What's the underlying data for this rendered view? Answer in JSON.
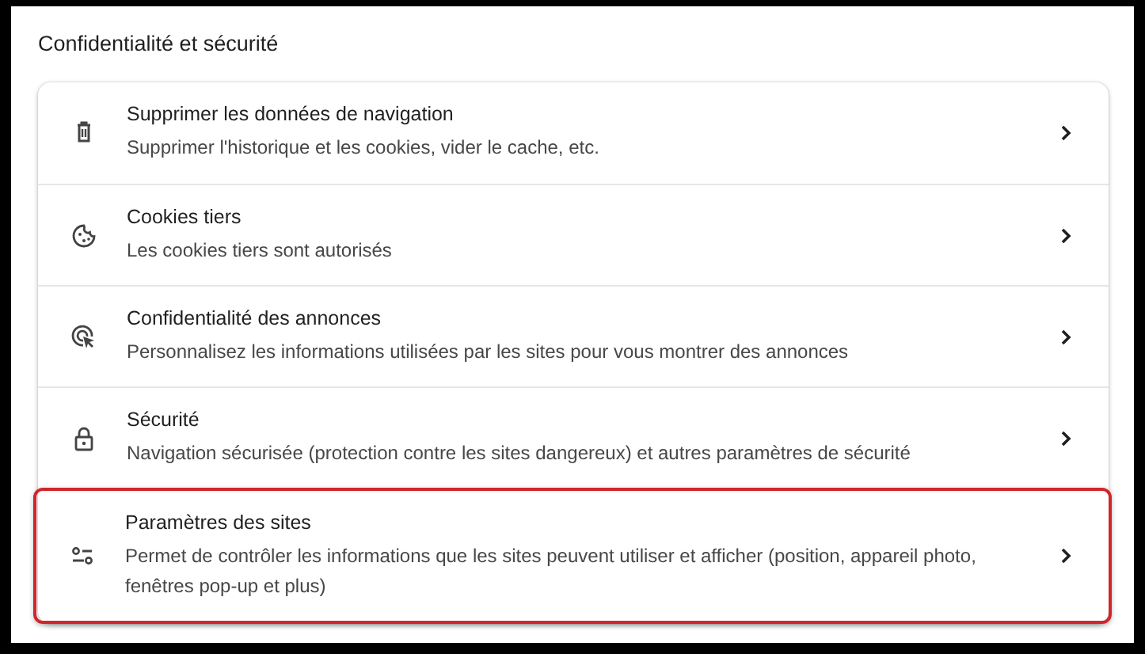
{
  "section": {
    "title": "Confidentialité et sécurité"
  },
  "items": [
    {
      "title": "Supprimer les données de navigation",
      "description": "Supprimer l'historique et les cookies, vider le cache, etc.",
      "highlighted": false
    },
    {
      "title": "Cookies tiers",
      "description": "Les cookies tiers sont autorisés",
      "highlighted": false
    },
    {
      "title": "Confidentialité des annonces",
      "description": "Personnalisez les informations utilisées par les sites pour vous montrer des annonces",
      "highlighted": false
    },
    {
      "title": "Sécurité",
      "description": "Navigation sécurisée (protection contre les sites dangereux) et autres paramètres de sécurité",
      "highlighted": false
    },
    {
      "title": "Paramètres des sites",
      "description": "Permet de contrôler les informations que les sites peuvent utiliser et afficher (position, appareil photo, fenêtres pop-up et plus)",
      "highlighted": true
    }
  ]
}
